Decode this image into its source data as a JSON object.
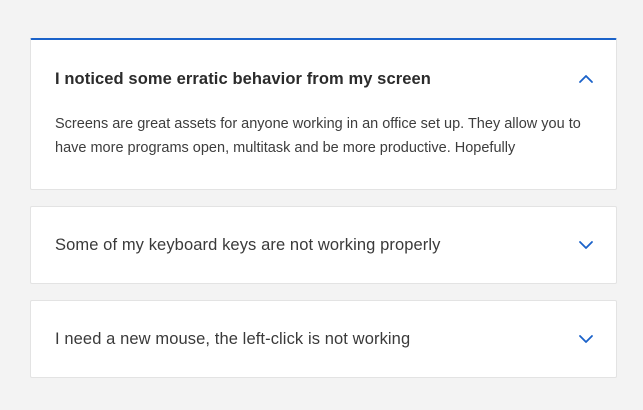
{
  "faq": {
    "items": [
      {
        "question": "I noticed some erratic behavior from my screen",
        "answer": "Screens are great assets for anyone working in an office set up. They allow you to have more programs open, multitask and be more productive. Hopefully",
        "state": "expanded",
        "icon": "chevron-up-icon"
      },
      {
        "question": "Some of my keyboard keys are not working properly",
        "state": "collapsed",
        "icon": "chevron-down-icon"
      },
      {
        "question": "I need a new mouse, the left-click is not working",
        "state": "collapsed",
        "icon": "chevron-down-icon"
      }
    ]
  },
  "colors": {
    "accent": "#1a62c9",
    "page_background": "#f3f3f3",
    "panel_background": "#ffffff"
  }
}
